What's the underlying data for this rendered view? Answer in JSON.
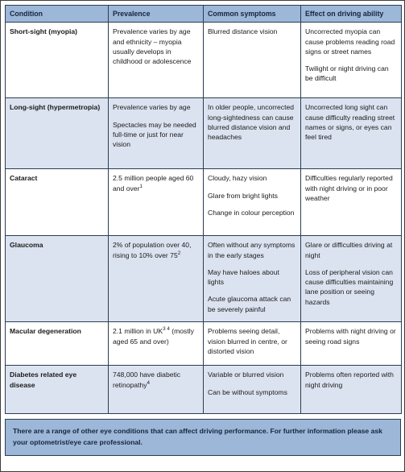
{
  "table": {
    "headers": [
      "Condition",
      "Prevalence",
      "Common symptoms",
      "Effect on driving ability"
    ],
    "rows": [
      {
        "condition": "Short-sight (myopia)",
        "prevalence": [
          "Prevalence varies by age and ethnicity – myopia usually develops in childhood or adolescence"
        ],
        "symptoms": [
          "Blurred distance vision"
        ],
        "effect": [
          "Uncorrected myopia can cause problems reading road signs or street names",
          "Twilight or night driving can be difficult"
        ]
      },
      {
        "condition": "Long-sight (hypermetropia)",
        "prevalence": [
          "Prevalence varies by age",
          "Spectacles may be needed full-time or just for near vision"
        ],
        "symptoms": [
          "In older people, uncorrected long-sightedness can cause blurred distance vision and headaches"
        ],
        "effect": [
          "Uncorrected long sight can cause difficulty reading street names or signs, or eyes can feel tired"
        ]
      },
      {
        "condition": "Cataract",
        "prevalence": [
          "2.5 million people aged 60 and over"
        ],
        "prevalence_sup": [
          "1"
        ],
        "symptoms": [
          "Cloudy, hazy vision",
          "Glare from bright lights",
          "Change in colour perception"
        ],
        "effect": [
          "Difficulties regularly reported with night driving or in poor weather"
        ]
      },
      {
        "condition": "Glaucoma",
        "prevalence": [
          "2% of population over 40, rising to 10% over 75"
        ],
        "prevalence_sup": [
          "2"
        ],
        "symptoms": [
          "Often without any symptoms in the early stages",
          "May have haloes about lights",
          "Acute glaucoma attack can be severely painful"
        ],
        "effect": [
          "Glare or difficulties driving at night",
          "Loss of peripheral vision can cause difficulties maintaining lane position or seeing hazards"
        ]
      },
      {
        "condition": "Macular degeneration",
        "prevalence": [
          "2.1 million in UK",
          " (mostly aged 65 and over)"
        ],
        "prevalence_sup": [
          "3 4"
        ],
        "symptoms": [
          "Problems seeing detail, vision blurred in centre, or distorted vision"
        ],
        "effect": [
          "Problems with night driving or seeing road signs"
        ]
      },
      {
        "condition": "Diabetes related eye disease",
        "prevalence": [
          "748,000 have diabetic retinopathy"
        ],
        "prevalence_sup": [
          "4"
        ],
        "symptoms": [
          "Variable or blurred vision",
          "Can be without symptoms"
        ],
        "effect": [
          "Problems often reported with night driving"
        ]
      }
    ]
  },
  "footnote": {
    "text": "There are a range of other eye conditions that can affect driving performance.  For further information please ask your optometrist/eye care professional."
  },
  "colors": {
    "header_fill": "#9DB7D9",
    "shaded_row_fill": "#DCE3F0",
    "plain_row_fill": "#FFFFFF",
    "border": "#2B3D52",
    "text": "#15253B"
  }
}
